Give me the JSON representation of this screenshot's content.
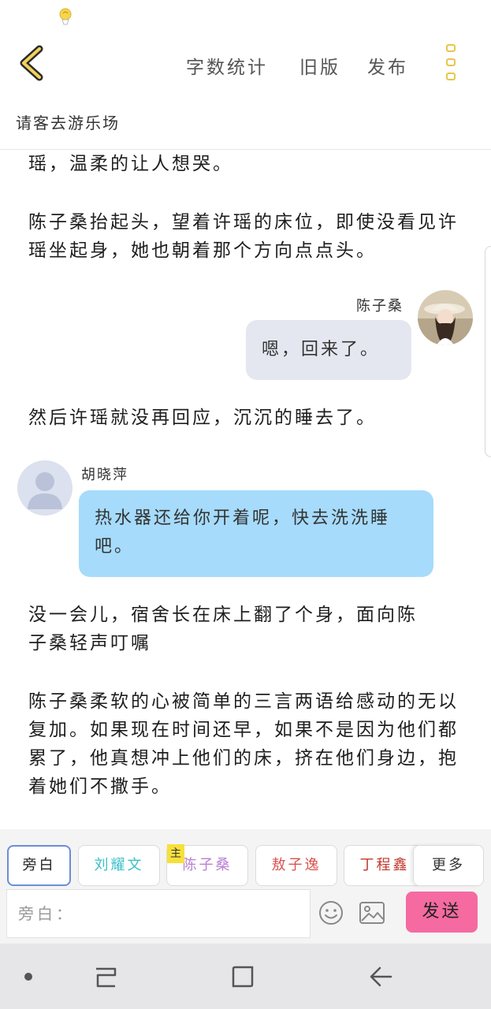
{
  "header": {
    "word_count_label": "字数统计",
    "old_version_label": "旧版",
    "publish_label": "发布"
  },
  "story": {
    "title": "请客去游乐场"
  },
  "content": {
    "paragraphs": [
      "瑶，温柔的让人想哭。",
      "陈子桑抬起头，望着许瑶的床位，即使没看见许瑶坐起身，她也朝着那个方向点点头。",
      "然后许瑶就没再回应，沉沉的睡去了。",
      "没一会儿，宿舍长在床上翻了个身，面向陈子桑轻声叮嘱",
      "陈子桑柔软的心被简单的三言两语给感动的无以复加。如果现在时间还早，如果不是因为他们都累了，他真想冲上他们的床，挤在他们身边，抱着她们不撒手。"
    ],
    "messages": [
      {
        "speaker": "陈子桑",
        "text": "嗯，回来了。",
        "bubble_color": "#e4e7ef"
      },
      {
        "speaker": "胡晓萍",
        "text": "热水器还给你开着呢，快去洗洗睡吧。",
        "bubble_color": "#a6dbfb"
      }
    ]
  },
  "toolbar": {
    "roles": [
      {
        "label": "旁白",
        "color": "#555555"
      },
      {
        "label": "刘耀文",
        "color": "#3bbfc9"
      },
      {
        "label": "陈子桑",
        "color": "#b77fd1",
        "badge": "主"
      },
      {
        "label": "敖子逸",
        "color": "#d9534f"
      },
      {
        "label": "丁程鑫",
        "color": "#c0392b"
      }
    ],
    "more_label": "更多",
    "input_placeholder": "旁白：",
    "send_label": "发送"
  },
  "colors": {
    "accent_yellow": "#e7c64b",
    "send_pink": "#f56aa0",
    "active_border": "#6b8fd6"
  }
}
